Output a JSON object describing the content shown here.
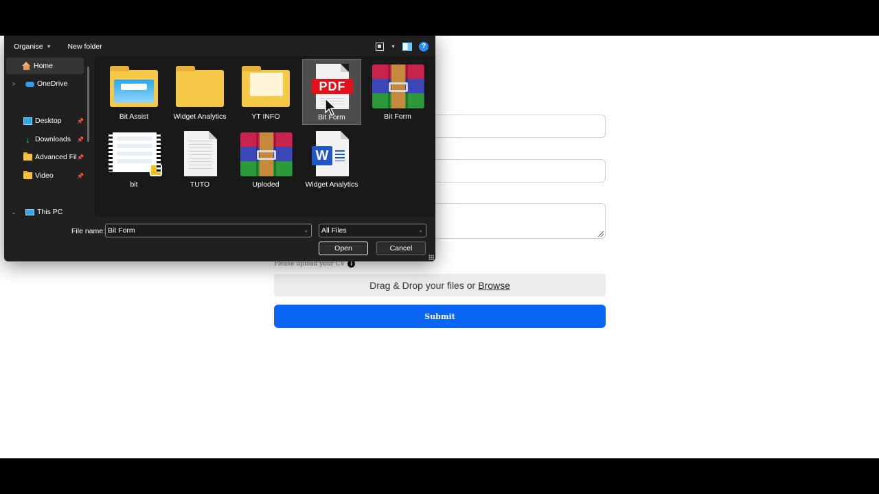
{
  "toolbar": {
    "organise_label": "Organise",
    "new_folder_label": "New folder",
    "help_glyph": "?"
  },
  "nav": {
    "items": [
      {
        "label": "Home",
        "icon": "home-icon",
        "selected": true
      },
      {
        "label": "OneDrive",
        "icon": "cloud-icon"
      },
      {
        "label": "Desktop",
        "icon": "desktop-icon",
        "pinned": true
      },
      {
        "label": "Downloads",
        "icon": "downloads-icon",
        "pinned": true
      },
      {
        "label": "Advanced Fil",
        "icon": "folder-icon",
        "pinned": true
      },
      {
        "label": "Video",
        "icon": "folder-icon",
        "pinned": true
      },
      {
        "label": "This PC",
        "icon": "pc-icon"
      }
    ]
  },
  "files": [
    {
      "name": "Bit Assist",
      "type": "folder-image"
    },
    {
      "name": "Widget Analytics",
      "type": "folder"
    },
    {
      "name": "YT INFO",
      "type": "folder-docs"
    },
    {
      "name": "Bit Form",
      "type": "pdf",
      "selected": true,
      "badge": "PDF"
    },
    {
      "name": "Bit Form",
      "type": "archive"
    },
    {
      "name": "bit",
      "type": "video"
    },
    {
      "name": "TUTO",
      "type": "document"
    },
    {
      "name": "Uploded",
      "type": "archive"
    },
    {
      "name": "Widget Analytics",
      "type": "word",
      "badge": "W"
    }
  ],
  "bottom": {
    "file_name_label": "File name:",
    "file_name_value": "Bit Form",
    "filter_value": "All Files",
    "open_label": "Open",
    "cancel_label": "Cancel"
  },
  "form": {
    "upload_label": "Please upload your CV",
    "upload_info_glyph": "i",
    "dropzone_text": "Drag & Drop your files or",
    "browse_text": "Browse",
    "submit_label": "Submit"
  },
  "colors": {
    "submit_bg": "#0b66f5",
    "dialog_bg": "#202020",
    "pdf_red": "#e3101b",
    "word_blue": "#1f58c6"
  }
}
